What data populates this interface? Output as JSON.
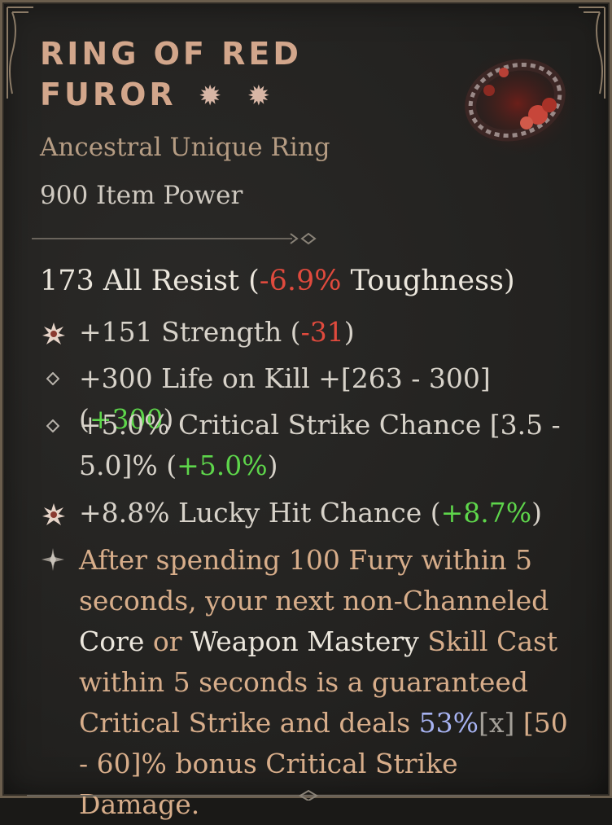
{
  "item": {
    "name_line1": "RING OF RED",
    "name_line2": "FUROR",
    "item_type": "Ancestral Unique Ring",
    "item_power": "900 Item Power"
  },
  "resist": {
    "label": "173 All Resist (",
    "value": "-6.9%",
    "suffix": " Toughness)"
  },
  "affixes": [
    {
      "icon": "greater-affix-icon",
      "text": "+151 Strength (",
      "delta": "-31",
      "delta_type": "negative",
      "tail": ")"
    },
    {
      "icon": "affix-diamond-icon",
      "text": "+300 Life on Kill +[263 - 300] (",
      "delta": "+300",
      "delta_type": "positive",
      "tail": ")"
    },
    {
      "icon": "affix-diamond-icon",
      "text_line1": "+5.0% Critical Strike Chance [3.5 -",
      "text_line2": "5.0]% (",
      "delta": "+5.0%",
      "delta_type": "positive",
      "tail": ")"
    },
    {
      "icon": "greater-affix-icon",
      "text": "+8.8% Lucky Hit Chance (",
      "delta": "+8.7%",
      "delta_type": "positive",
      "tail": ")"
    }
  ],
  "unique_power": {
    "icon": "unique-power-star-icon",
    "p1": "After spending 100 Fury within 5 seconds, your next non-Channeled ",
    "core": "Core",
    "p2": " or ",
    "weapon_mastery": "Weapon Mastery",
    "p3": " Skill Cast within 5 seconds is a guaranteed Critical Strike and deals ",
    "value": "53%",
    "x_tag": "[x]",
    "p4": " [50 - 60]% bonus Critical Strike Damage."
  },
  "colors": {
    "title": "#d2a68b",
    "negative": "#e04a3d",
    "positive": "#5ed64b",
    "unique_text": "#d7ad8a",
    "value_blue": "#a7b3f2",
    "border": "#6b5e4d"
  }
}
